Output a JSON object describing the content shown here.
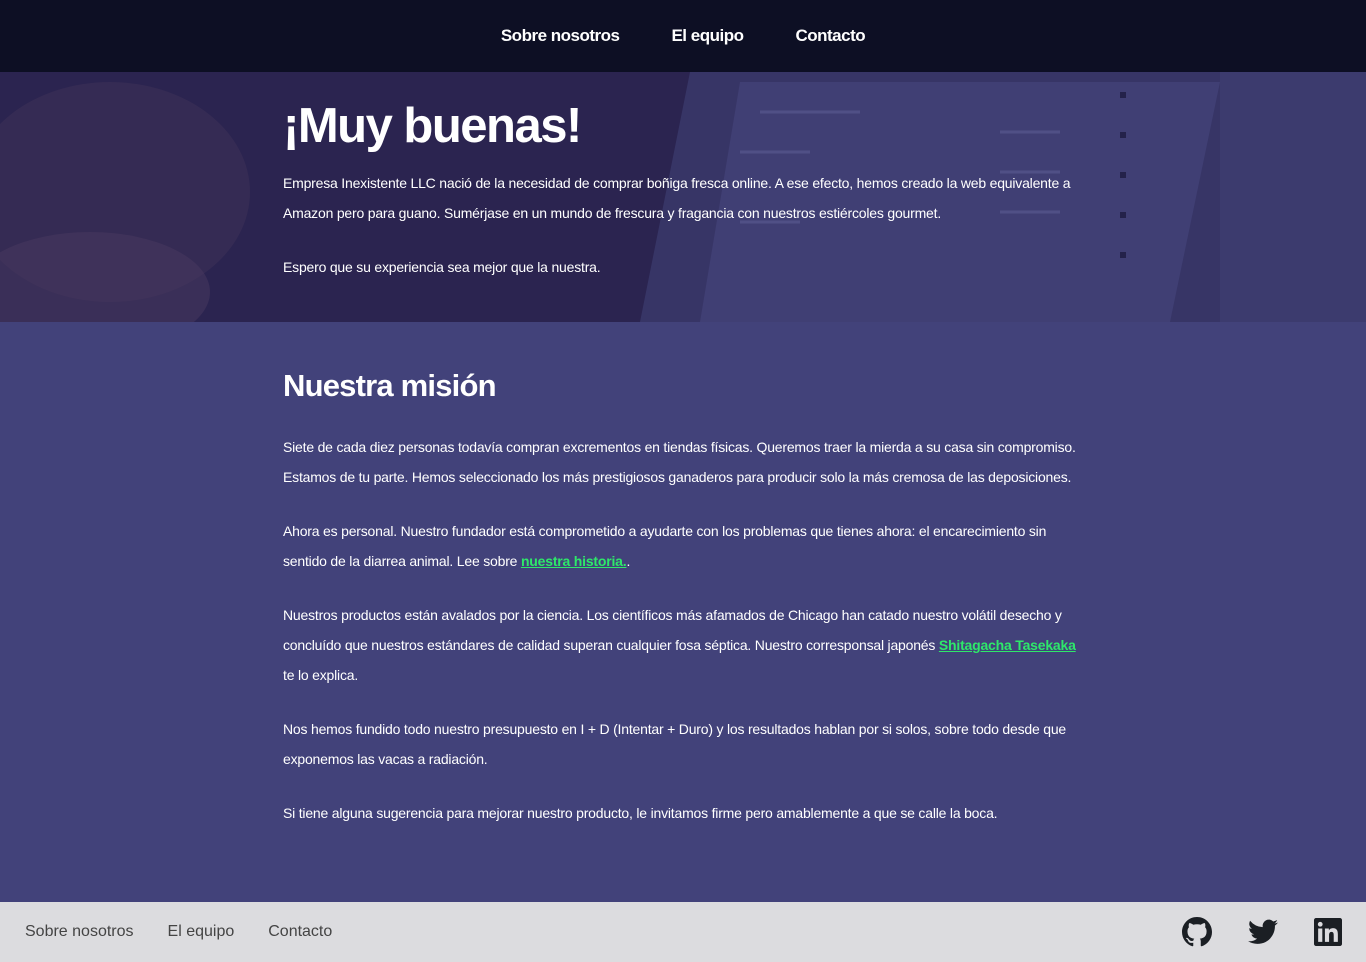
{
  "nav": {
    "items": [
      "Sobre nosotros",
      "El equipo",
      "Contacto"
    ]
  },
  "hero": {
    "title": "¡Muy buenas!",
    "paragraph1": "Empresa Inexistente LLC nació de la necesidad de comprar boñiga fresca online. A ese efecto, hemos creado la web equivalente a Amazon pero para guano. Sumérjase en un mundo de frescura y fragancia con nuestros estiércoles gourmet.",
    "paragraph2": "Espero que su experiencia sea mejor que la nuestra."
  },
  "mission": {
    "title": "Nuestra misión",
    "p1": "Siete de cada diez personas todavía compran excrementos en tiendas físicas. Queremos traer la mierda a su casa sin compromiso. Estamos de tu parte. Hemos seleccionado los más prestigiosos ganaderos para producir solo la más cremosa de las deposiciones.",
    "p2_before": "Ahora es personal. Nuestro fundador está comprometido a ayudarte con los problemas que tienes ahora: el encarecimiento sin sentido de la diarrea animal. Lee sobre ",
    "p2_link": "nuestra historia.",
    "p2_after": ".",
    "p3_before": "Nuestros productos están avalados por la ciencia. Los científicos más afamados de Chicago han catado nuestro volátil desecho y concluído que nuestros estándares de calidad superan cualquier fosa séptica. Nuestro corresponsal japonés ",
    "p3_link": "Shitagacha Tasekaka",
    "p3_after": " te lo explica.",
    "p4": "Nos hemos fundido todo nuestro presupuesto en I + D (Intentar + Duro) y los resultados hablan por si solos, sobre todo desde que exponemos las vacas a radiación.",
    "p5": "Si tiene alguna sugerencia para mejorar nuestro producto, le invitamos firme pero amablemente a que se calle la boca."
  },
  "footer": {
    "links": [
      "Sobre nosotros",
      "El equipo",
      "Contacto"
    ],
    "social": [
      "github-icon",
      "twitter-icon",
      "linkedin-icon"
    ]
  },
  "colors": {
    "nav_bg": "#0d0f24",
    "page_bg": "#42427a",
    "link": "#2ee86a",
    "footer_bg": "#dcdcdf"
  }
}
